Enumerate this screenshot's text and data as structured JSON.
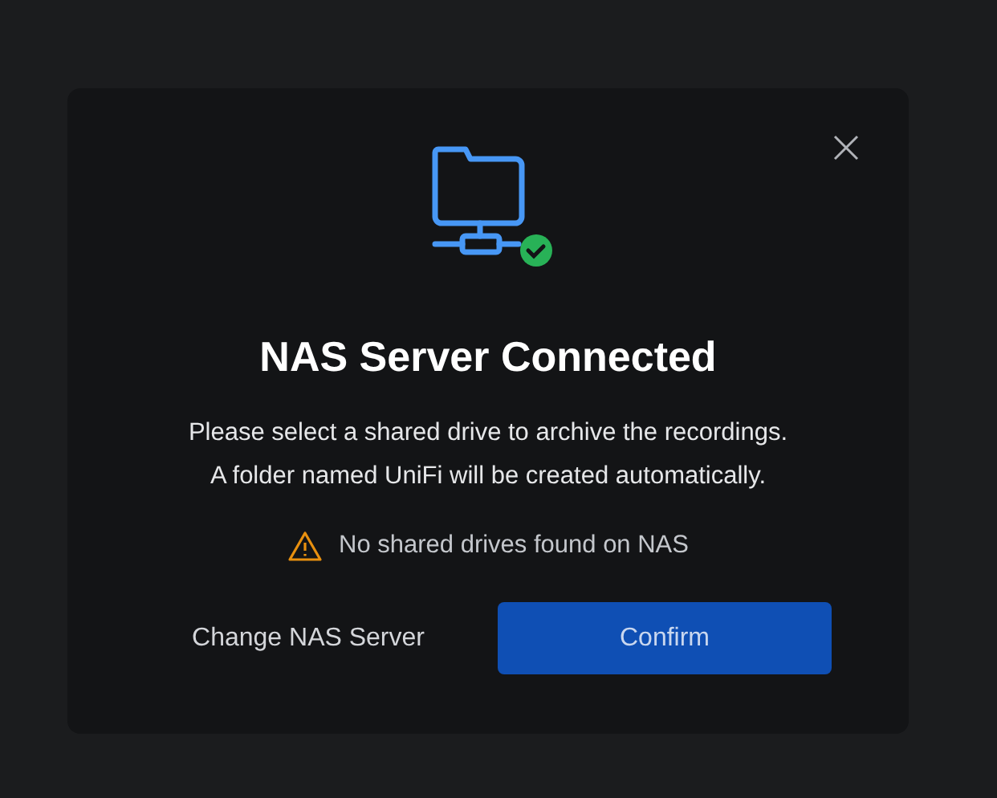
{
  "dialog": {
    "title": "NAS Server Connected",
    "description": [
      "Please select a shared drive to archive the recordings.",
      "A folder named UniFi will be created automatically."
    ],
    "warning": "No shared drives found on NAS",
    "buttons": [
      {
        "label": "Change NAS Server",
        "kind": "secondary"
      },
      {
        "label": "Confirm",
        "kind": "primary"
      }
    ]
  }
}
